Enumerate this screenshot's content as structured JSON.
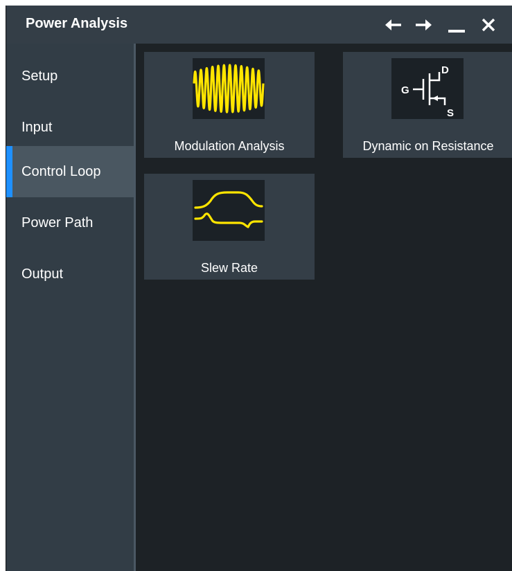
{
  "window": {
    "title": "Power Analysis",
    "controls": [
      "back-arrow-icon",
      "forward-arrow-icon",
      "minimize-icon",
      "close-icon"
    ]
  },
  "sidebar": {
    "items": [
      {
        "label": "Setup",
        "active": false
      },
      {
        "label": "Input",
        "active": false
      },
      {
        "label": "Control Loop",
        "active": true
      },
      {
        "label": "Power Path",
        "active": false
      },
      {
        "label": "Output",
        "active": false
      }
    ]
  },
  "main": {
    "tiles": [
      {
        "label": "Modulation Analysis",
        "icon": "modulation-waveform-icon"
      },
      {
        "label": "Dynamic on Resistance",
        "icon": "mosfet-icon",
        "terminals": {
          "gate": "G",
          "drain": "D",
          "source": "S"
        }
      },
      {
        "label": "Slew Rate",
        "icon": "slew-rate-waveform-icon"
      }
    ]
  },
  "colors": {
    "accent": "#1e90ff",
    "waveform": "#ffe500",
    "titlebar": "#343e47",
    "sidebar": "#323d46",
    "active_item": "#4a5761",
    "content_bg": "#1d2226"
  }
}
